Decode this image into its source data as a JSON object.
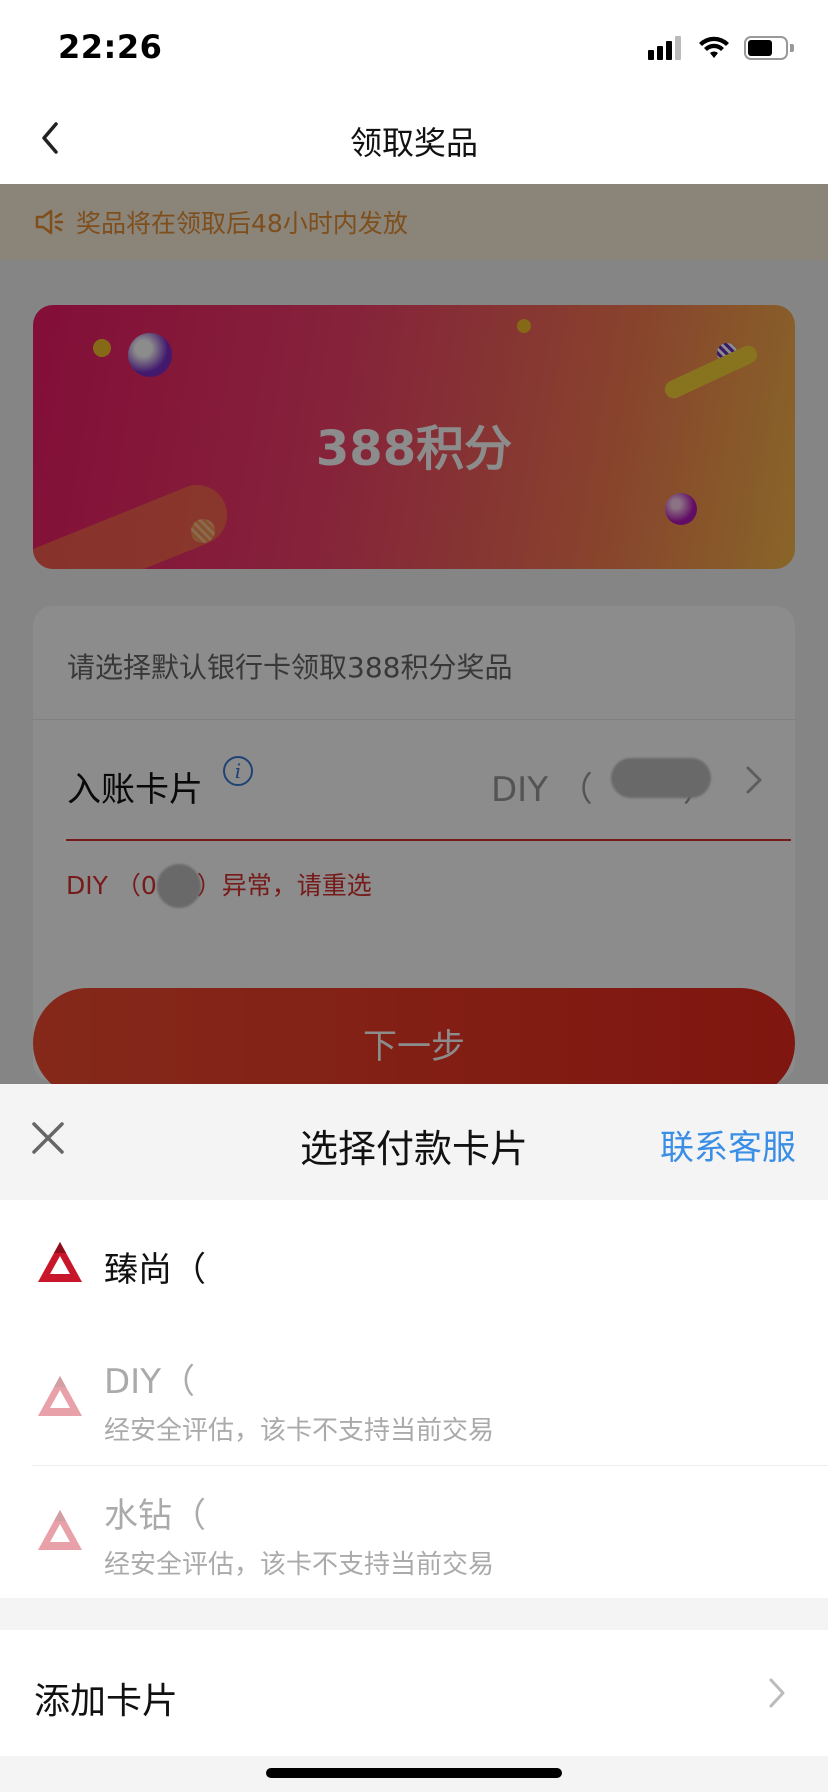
{
  "status_bar": {
    "time": "22:26"
  },
  "nav": {
    "title": "领取奖品"
  },
  "notice": {
    "text": "奖品将在领取后48小时内发放"
  },
  "prize": {
    "text": "388积分"
  },
  "form": {
    "hint": "请选择默认银行卡领取388积分奖品",
    "card_label": "入账卡片",
    "card_value": "DIY （",
    "card_value_close": "）",
    "error_text": "DIY （0",
    "error_text_suffix": "）异常，请重选"
  },
  "next_button": {
    "label": "下一步"
  },
  "sheet": {
    "title": "选择付款卡片",
    "service_link": "联系客服",
    "cards": [
      {
        "name": "臻尚（",
        "subtitle": "",
        "enabled": true
      },
      {
        "name": "DIY（",
        "subtitle": "经安全评估，该卡不支持当前交易",
        "enabled": false
      },
      {
        "name": "水钻（",
        "subtitle": "经安全评估，该卡不支持当前交易",
        "enabled": false
      }
    ],
    "add_card_label": "添加卡片"
  },
  "colors": {
    "accent_blue": "#3a8ee6",
    "error_red": "#d93030",
    "notice_orange": "#e59035",
    "button_red": "#e8281c"
  }
}
